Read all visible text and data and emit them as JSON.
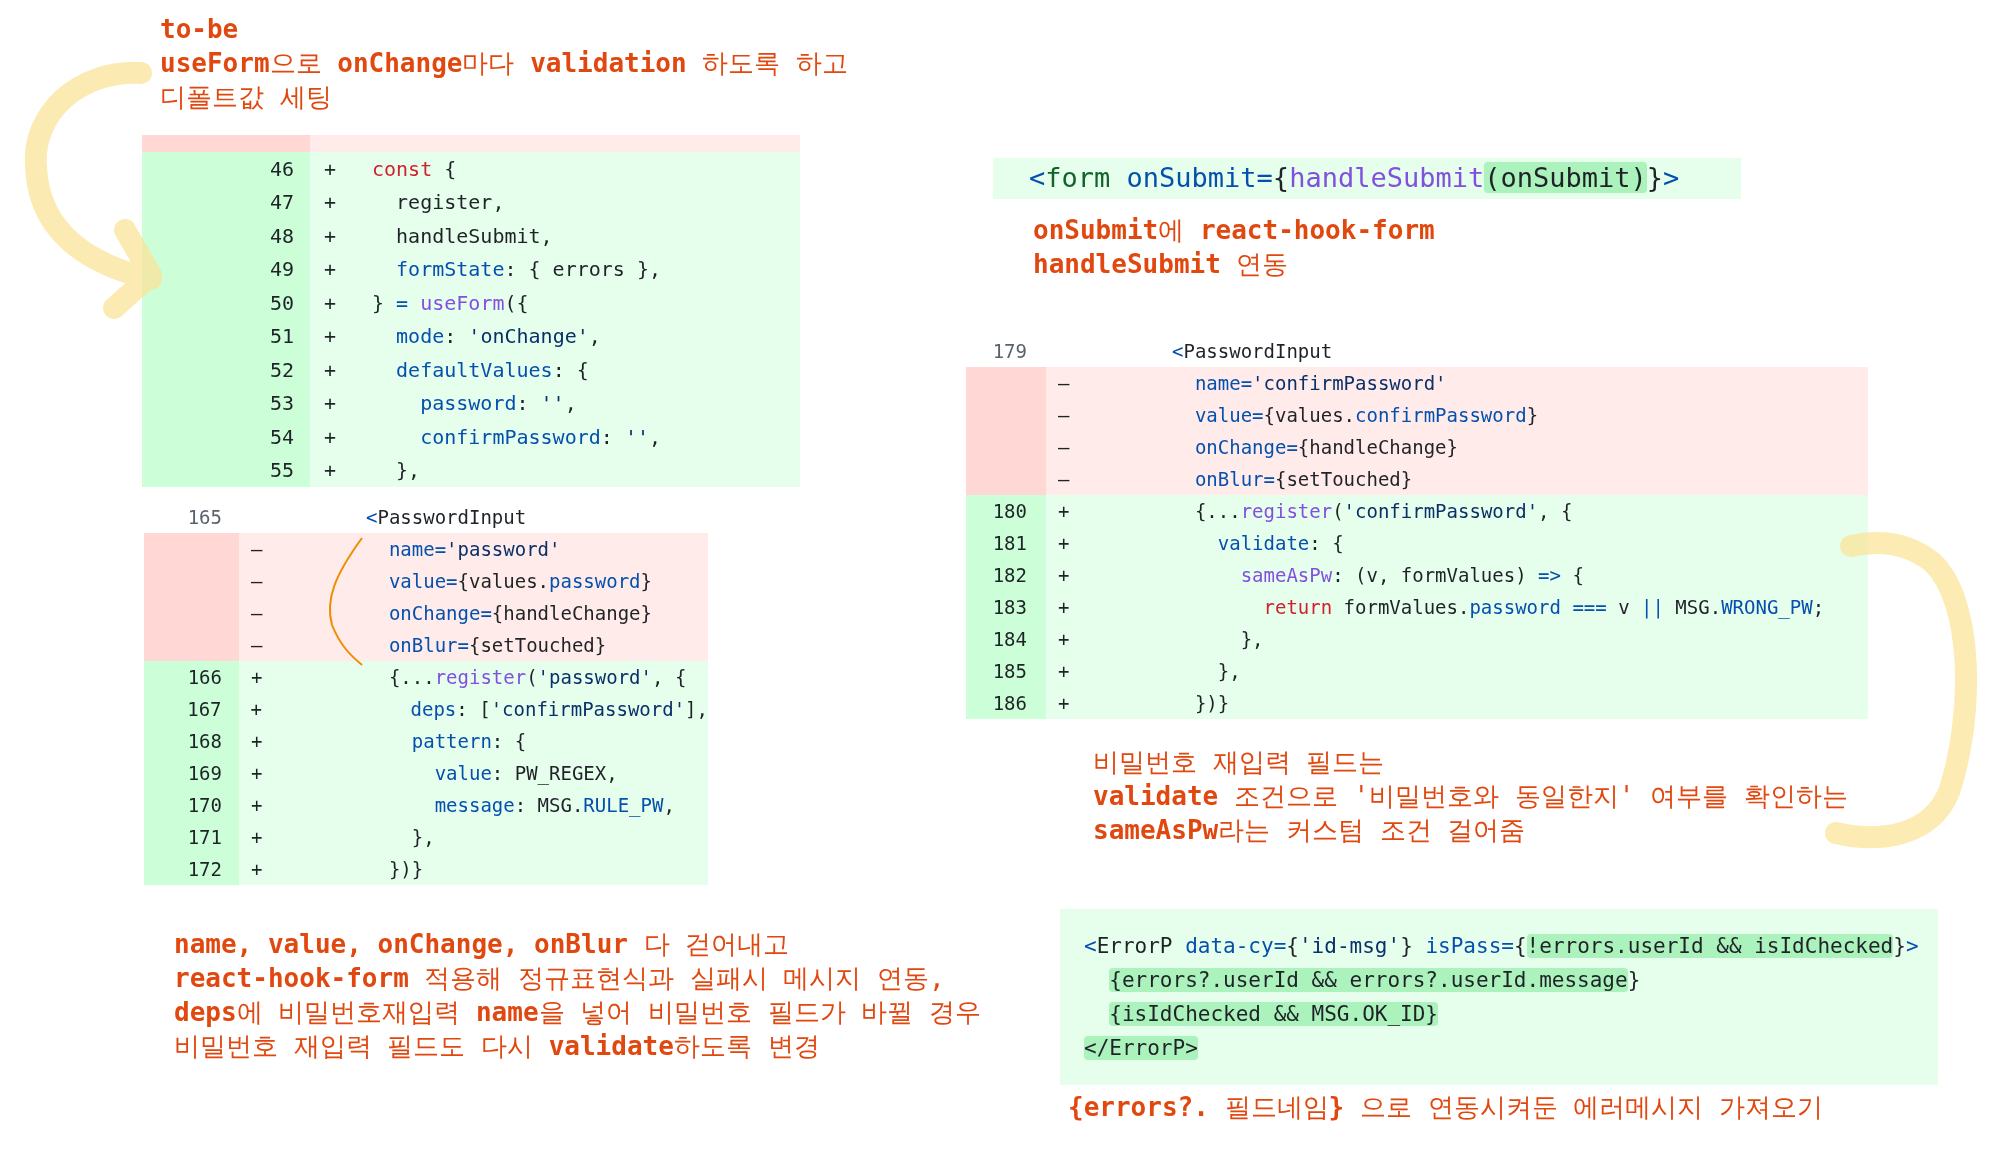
{
  "panels": [
    {
      "kind": "annotation",
      "lines": [
        "**to-be**",
        "**useForm**으로 **onChange**마다 **validation** 하도록 하고",
        "디폴트값 세팅"
      ]
    },
    {
      "kind": "diff",
      "lines": [
        {
          "kind": "deleted",
          "clipped": true
        },
        {
          "kind": "added",
          "num": "46",
          "sign": "+",
          "tokens": [
            {
              "text": "const",
              "kind": "keyword"
            },
            {
              "text": " {",
              "kind": "plain"
            }
          ]
        },
        {
          "kind": "added",
          "num": "47",
          "sign": "+",
          "tokens": [
            {
              "text": "  register,",
              "kind": "plain"
            }
          ]
        },
        {
          "kind": "added",
          "num": "48",
          "sign": "+",
          "tokens": [
            {
              "text": "  handleSubmit,",
              "kind": "plain"
            }
          ]
        },
        {
          "kind": "added",
          "num": "49",
          "sign": "+",
          "tokens": [
            {
              "text": "  formState",
              "kind": "property"
            },
            {
              "text": ": { errors },",
              "kind": "plain"
            }
          ]
        },
        {
          "kind": "added",
          "num": "50",
          "sign": "+",
          "tokens": [
            {
              "text": "} ",
              "kind": "plain"
            },
            {
              "text": "=",
              "kind": "property"
            },
            {
              "text": " useForm",
              "kind": "function"
            },
            {
              "text": "({",
              "kind": "plain"
            }
          ]
        },
        {
          "kind": "added",
          "num": "51",
          "sign": "+",
          "tokens": [
            {
              "text": "  mode",
              "kind": "property"
            },
            {
              "text": ": ",
              "kind": "plain"
            },
            {
              "text": "'onChange'",
              "kind": "string"
            },
            {
              "text": ",",
              "kind": "plain"
            }
          ]
        },
        {
          "kind": "added",
          "num": "52",
          "sign": "+",
          "tokens": [
            {
              "text": "  defaultValues",
              "kind": "property"
            },
            {
              "text": ": {",
              "kind": "plain"
            }
          ]
        },
        {
          "kind": "added",
          "num": "53",
          "sign": "+",
          "tokens": [
            {
              "text": "    password",
              "kind": "property"
            },
            {
              "text": ": ",
              "kind": "plain"
            },
            {
              "text": "''",
              "kind": "string"
            },
            {
              "text": ",",
              "kind": "plain"
            }
          ]
        },
        {
          "kind": "added",
          "num": "54",
          "sign": "+",
          "tokens": [
            {
              "text": "    confirmPassword",
              "kind": "property"
            },
            {
              "text": ": ",
              "kind": "plain"
            },
            {
              "text": "''",
              "kind": "string"
            },
            {
              "text": ",",
              "kind": "plain"
            }
          ]
        },
        {
          "kind": "added",
          "num": "55",
          "sign": "+",
          "tokens": [
            {
              "text": "  },",
              "kind": "plain"
            }
          ]
        }
      ]
    },
    {
      "kind": "snippet",
      "lines": [
        [
          {
            "text": "<",
            "kind": "property"
          },
          {
            "text": "form",
            "kind": "tag"
          },
          {
            "text": " onSubmit=",
            "kind": "property"
          },
          {
            "text": "{",
            "kind": "plain"
          },
          {
            "text": "handleSubmit",
            "kind": "function"
          },
          {
            "text": "(onSubmit)",
            "kind": "mark"
          },
          {
            "text": "}",
            "kind": "plain"
          },
          {
            "text": ">",
            "kind": "property"
          }
        ]
      ]
    },
    {
      "kind": "annotation",
      "lines": [
        "**onSubmit**에 **react-hook-form**",
        "**handleSubmit** 연동"
      ]
    },
    {
      "kind": "diff",
      "lines": [
        {
          "kind": "context",
          "num": "179",
          "tokens": [
            {
              "text": "<",
              "kind": "property"
            },
            {
              "text": "PasswordInput",
              "kind": "plain"
            }
          ]
        },
        {
          "kind": "deleted",
          "sign": "–",
          "tokens": [
            {
              "text": "  name=",
              "kind": "property"
            },
            {
              "text": "'confirmPassword'",
              "kind": "string"
            }
          ]
        },
        {
          "kind": "deleted",
          "sign": "–",
          "tokens": [
            {
              "text": "  value=",
              "kind": "property"
            },
            {
              "text": "{values.",
              "kind": "plain"
            },
            {
              "text": "confirmPassword",
              "kind": "property"
            },
            {
              "text": "}",
              "kind": "plain"
            }
          ]
        },
        {
          "kind": "deleted",
          "sign": "–",
          "tokens": [
            {
              "text": "  onChange=",
              "kind": "property"
            },
            {
              "text": "{handleChange}",
              "kind": "plain"
            }
          ]
        },
        {
          "kind": "deleted",
          "sign": "–",
          "tokens": [
            {
              "text": "  onBlur=",
              "kind": "property"
            },
            {
              "text": "{setTouched}",
              "kind": "plain"
            }
          ]
        },
        {
          "kind": "added",
          "num": "180",
          "sign": "+",
          "tokens": [
            {
              "text": "  {...",
              "kind": "plain"
            },
            {
              "text": "register",
              "kind": "function"
            },
            {
              "text": "(",
              "kind": "plain"
            },
            {
              "text": "'confirmPassword'",
              "kind": "string"
            },
            {
              "text": ", {",
              "kind": "plain"
            }
          ]
        },
        {
          "kind": "added",
          "num": "181",
          "sign": "+",
          "tokens": [
            {
              "text": "    validate",
              "kind": "property"
            },
            {
              "text": ": {",
              "kind": "plain"
            }
          ]
        },
        {
          "kind": "added",
          "num": "182",
          "sign": "+",
          "tokens": [
            {
              "text": "      sameAsPw",
              "kind": "function"
            },
            {
              "text": ": (v, formValues) ",
              "kind": "plain"
            },
            {
              "text": "=>",
              "kind": "property"
            },
            {
              "text": " {",
              "kind": "plain"
            }
          ]
        },
        {
          "kind": "added",
          "num": "183",
          "sign": "+",
          "tokens": [
            {
              "text": "        return",
              "kind": "keyword"
            },
            {
              "text": " formValues.",
              "kind": "plain"
            },
            {
              "text": "password",
              "kind": "property"
            },
            {
              "text": " ===",
              "kind": "property"
            },
            {
              "text": " v ",
              "kind": "plain"
            },
            {
              "text": "||",
              "kind": "property"
            },
            {
              "text": " MSG.",
              "kind": "plain"
            },
            {
              "text": "WRONG_PW",
              "kind": "property"
            },
            {
              "text": ";",
              "kind": "plain"
            }
          ]
        },
        {
          "kind": "added",
          "num": "184",
          "sign": "+",
          "tokens": [
            {
              "text": "      },",
              "kind": "plain"
            }
          ]
        },
        {
          "kind": "added",
          "num": "185",
          "sign": "+",
          "tokens": [
            {
              "text": "    },",
              "kind": "plain"
            }
          ]
        },
        {
          "kind": "added",
          "num": "186",
          "sign": "+",
          "tokens": [
            {
              "text": "  })}",
              "kind": "plain"
            }
          ]
        }
      ]
    },
    {
      "kind": "diff",
      "lines": [
        {
          "kind": "context",
          "num": "165",
          "tokens": [
            {
              "text": "<",
              "kind": "property"
            },
            {
              "text": "PasswordInput",
              "kind": "plain"
            }
          ]
        },
        {
          "kind": "deleted",
          "sign": "–",
          "tokens": [
            {
              "text": "  name=",
              "kind": "property"
            },
            {
              "text": "'password'",
              "kind": "string"
            }
          ]
        },
        {
          "kind": "deleted",
          "sign": "–",
          "tokens": [
            {
              "text": "  value=",
              "kind": "property"
            },
            {
              "text": "{values.",
              "kind": "plain"
            },
            {
              "text": "password",
              "kind": "property"
            },
            {
              "text": "}",
              "kind": "plain"
            }
          ]
        },
        {
          "kind": "deleted",
          "sign": "–",
          "tokens": [
            {
              "text": "  onChange=",
              "kind": "property"
            },
            {
              "text": "{handleChange}",
              "kind": "plain"
            }
          ]
        },
        {
          "kind": "deleted",
          "sign": "–",
          "tokens": [
            {
              "text": "  onBlur=",
              "kind": "property"
            },
            {
              "text": "{setTouched}",
              "kind": "plain"
            }
          ]
        },
        {
          "kind": "added",
          "num": "166",
          "sign": "+",
          "tokens": [
            {
              "text": "  {...",
              "kind": "plain"
            },
            {
              "text": "register",
              "kind": "function"
            },
            {
              "text": "(",
              "kind": "plain"
            },
            {
              "text": "'password'",
              "kind": "string"
            },
            {
              "text": ", {",
              "kind": "plain"
            }
          ]
        },
        {
          "kind": "added",
          "num": "167",
          "sign": "+",
          "tokens": [
            {
              "text": "    deps",
              "kind": "property"
            },
            {
              "text": ": [",
              "kind": "plain"
            },
            {
              "text": "'confirmPassword'",
              "kind": "string"
            },
            {
              "text": "],",
              "kind": "plain"
            }
          ]
        },
        {
          "kind": "added",
          "num": "168",
          "sign": "+",
          "tokens": [
            {
              "text": "    pattern",
              "kind": "property"
            },
            {
              "text": ": {",
              "kind": "plain"
            }
          ]
        },
        {
          "kind": "added",
          "num": "169",
          "sign": "+",
          "tokens": [
            {
              "text": "      value",
              "kind": "property"
            },
            {
              "text": ": PW_REGEX,",
              "kind": "plain"
            }
          ]
        },
        {
          "kind": "added",
          "num": "170",
          "sign": "+",
          "tokens": [
            {
              "text": "      message",
              "kind": "property"
            },
            {
              "text": ": MSG.",
              "kind": "plain"
            },
            {
              "text": "RULE_PW",
              "kind": "property"
            },
            {
              "text": ",",
              "kind": "plain"
            }
          ]
        },
        {
          "kind": "added",
          "num": "171",
          "sign": "+",
          "tokens": [
            {
              "text": "    },",
              "kind": "plain"
            }
          ]
        },
        {
          "kind": "added",
          "num": "172",
          "sign": "+",
          "tokens": [
            {
              "text": "  })}",
              "kind": "plain"
            }
          ]
        }
      ]
    },
    {
      "kind": "annotation",
      "lines": [
        "비밀번호 재입력 필드는",
        "**validate** 조건으로 '비밀번호와 동일한지' 여부를 확인하는",
        "**sameAsPw**라는 커스텀 조건 걸어줌"
      ]
    },
    {
      "kind": "annotation",
      "lines": [
        "**name, value, onChange, onBlur** 다 걷어내고",
        "**react-hook-form** 적용해 정규표현식과 실패시 메시지 연동,",
        "**deps**에 비밀번호재입력 **name**을 넣어 비밀번호 필드가 바뀔 경우",
        "비밀번호 재입력 필드도 다시 **validate**하도록 변경"
      ]
    },
    {
      "kind": "snippet",
      "lines": [
        [
          {
            "text": "<",
            "kind": "property"
          },
          {
            "text": "ErrorP",
            "kind": "plain"
          },
          {
            "text": " data-cy=",
            "kind": "property"
          },
          {
            "text": "{",
            "kind": "plain"
          },
          {
            "text": "'id-msg'",
            "kind": "string"
          },
          {
            "text": "}",
            "kind": "plain"
          },
          {
            "text": " isPass=",
            "kind": "property"
          },
          {
            "text": "{",
            "kind": "plain"
          },
          {
            "text": "!errors.userId && isIdChecked",
            "kind": "mark"
          },
          {
            "text": "}",
            "kind": "plain"
          },
          {
            "text": ">",
            "kind": "property"
          }
        ],
        [
          {
            "text": "  {errors?.userId && errors?.userId.message",
            "kind": "mark"
          },
          {
            "text": "}",
            "kind": "plain"
          }
        ],
        [
          {
            "text": "  {isIdChecked && MSG.OK_ID}",
            "kind": "mark"
          }
        ],
        [
          {
            "text": "</ErrorP>",
            "kind": "mark"
          }
        ]
      ]
    },
    {
      "kind": "annotation",
      "lines": [
        "**{errors?.** 필드네임**}** 으로 연동시켜둔 에러메시지 가져오기"
      ]
    }
  ]
}
